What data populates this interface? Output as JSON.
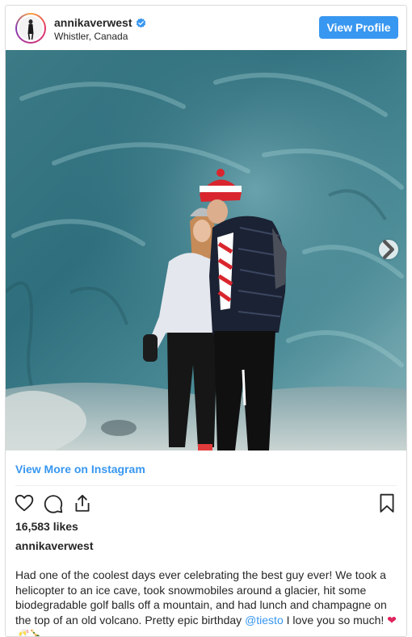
{
  "post": {
    "username": "annikaverwest",
    "location": "Whistler, Canada",
    "view_profile_label": "View Profile",
    "view_more_label": "View More on Instagram",
    "likes": "16,583 likes",
    "owner": "annikaverwest",
    "caption_before": "Had one of the coolest days ever celebrating the best guy ever! We took a helicopter to an ice cave, took snowmobiles around a glacier, hit some biodegradable golf balls off a mountain, and had lunch and champagne on the top of an old volcano. Pretty epic birthday ",
    "caption_mention": "@tiesto",
    "caption_after": " I love you so much! ",
    "caption_emojis": "❤🥂🍾"
  },
  "colors": {
    "accent": "#3897f0",
    "text": "#262626",
    "border": "#dbdbdb"
  },
  "icons": [
    "verified-badge-icon",
    "chevron-right-icon",
    "heart-icon",
    "comment-icon",
    "share-icon",
    "bookmark-icon"
  ]
}
